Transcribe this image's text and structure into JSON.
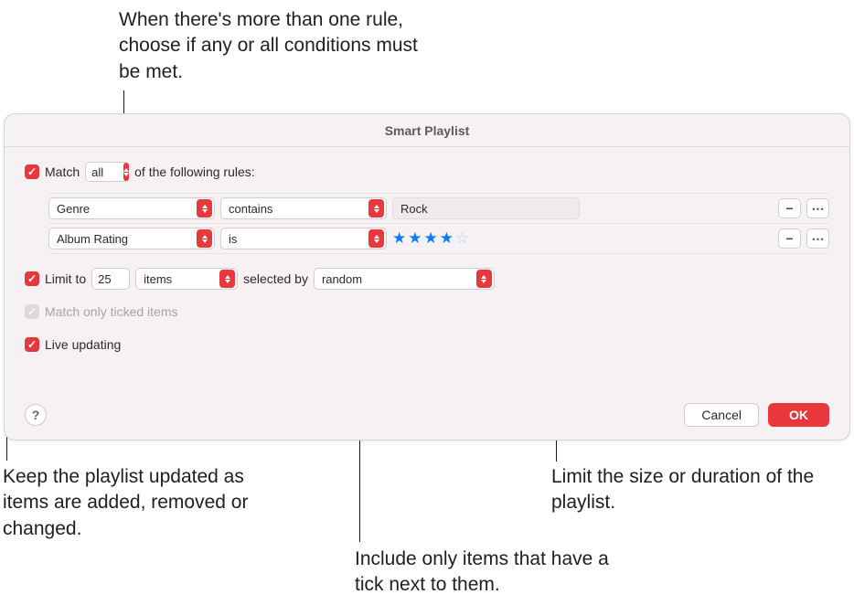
{
  "annot": {
    "top": "When there's more than one rule, choose if any or all conditions must be met.",
    "left": "Keep the playlist updated as items are added, removed or changed.",
    "center": "Include only items that have a tick next to them.",
    "right": "Limit the size or duration of the playlist."
  },
  "dialog": {
    "title": "Smart Playlist",
    "match_label_pre": "Match",
    "match_mode": "all",
    "match_label_post": "of the following rules:",
    "rules": [
      {
        "field": "Genre",
        "op": "contains",
        "value_text": "Rock",
        "stars": null
      },
      {
        "field": "Album Rating",
        "op": "is",
        "value_text": null,
        "stars": 4
      }
    ],
    "limit": {
      "label": "Limit to",
      "count": "25",
      "unit": "items",
      "selected_by_label": "selected by",
      "selected_by": "random"
    },
    "match_ticked_label": "Match only ticked items",
    "live_updating_label": "Live updating",
    "buttons": {
      "help": "?",
      "cancel": "Cancel",
      "ok": "OK"
    }
  }
}
